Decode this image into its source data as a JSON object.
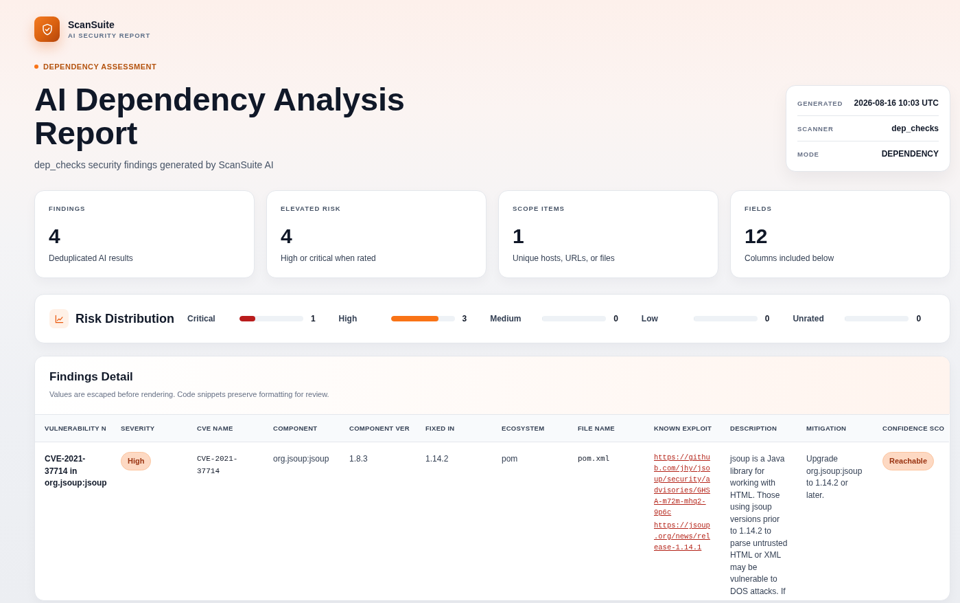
{
  "brand": {
    "name": "ScanSuite",
    "tagline": "AI SECURITY REPORT"
  },
  "hero": {
    "eyebrow": "DEPENDENCY ASSESSMENT",
    "title": "AI Dependency Analysis Report",
    "subtitle": "dep_checks security findings generated by ScanSuite AI"
  },
  "meta": [
    {
      "label": "GENERATED",
      "value": "2026-08-16 10:03 UTC"
    },
    {
      "label": "SCANNER",
      "value": "dep_checks"
    },
    {
      "label": "MODE",
      "value": "DEPENDENCY"
    }
  ],
  "stats": [
    {
      "label": "FINDINGS",
      "value": "4",
      "note": "Deduplicated AI results"
    },
    {
      "label": "ELEVATED RISK",
      "value": "4",
      "note": "High or critical when rated"
    },
    {
      "label": "SCOPE ITEMS",
      "value": "1",
      "note": "Unique hosts, URLs, or files"
    },
    {
      "label": "FIELDS",
      "value": "12",
      "note": "Columns included below"
    }
  ],
  "risk_distribution": {
    "title": "Risk Distribution",
    "items": [
      {
        "label": "Critical",
        "count": "1",
        "level": 0.25,
        "color": "#b91c1c"
      },
      {
        "label": "High",
        "count": "3",
        "level": 0.75,
        "color": "#f97316"
      },
      {
        "label": "Medium",
        "count": "0",
        "level": 0
      },
      {
        "label": "Low",
        "count": "0",
        "level": 0
      },
      {
        "label": "Unrated",
        "count": "0",
        "level": 0
      }
    ]
  },
  "findings": {
    "title": "Findings Detail",
    "subtitle": "Values are escaped before rendering. Code snippets preserve formatting for review.",
    "table": {
      "columns": [
        "VULNERABILITY N",
        "SEVERITY",
        "CVE NAME",
        "COMPONENT",
        "COMPONENT VER",
        "FIXED IN",
        "ECOSYSTEM",
        "FILE NAME",
        "KNOWN EXPLOIT",
        "DESCRIPTION",
        "MITIGATION",
        "CONFIDENCE SCO"
      ],
      "rows": [
        {
          "cells": [
            {
              "kind": "strong",
              "text": "CVE-2021-37714 in org.jsoup:jsoup"
            },
            {
              "kind": "badge",
              "text": "High"
            },
            {
              "kind": "mono",
              "text": "CVE-2021-37714"
            },
            {
              "kind": "text",
              "text": "org.jsoup:jsoup"
            },
            {
              "kind": "text",
              "text": "1.8.3"
            },
            {
              "kind": "text",
              "text": "1.14.2"
            },
            {
              "kind": "text",
              "text": "pom"
            },
            {
              "kind": "mono",
              "text": "pom.xml"
            },
            {
              "kind": "links",
              "links": [
                "https://github.com/jhy/jsoup/security/advisories/GHSA-m72m-mhq2-9p6c",
                "https://jsoup.org/news/release-1.14.1"
              ]
            },
            {
              "kind": "text",
              "text": "jsoup is a Java library for working with HTML. Those using jsoup versions prior to 1.14.2 to parse untrusted HTML or XML may be vulnerable to DOS attacks. If"
            },
            {
              "kind": "text",
              "text": "Upgrade org.jsoup:jsoup to 1.14.2 or later."
            },
            {
              "kind": "badge",
              "text": "Reachable"
            }
          ]
        }
      ]
    }
  }
}
